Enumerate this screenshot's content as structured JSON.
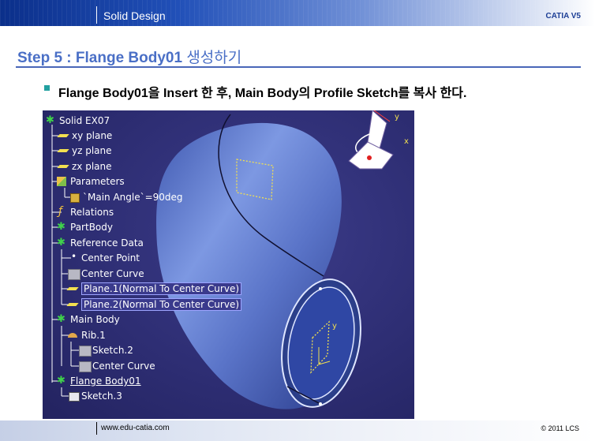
{
  "header": {
    "title": "Solid Design",
    "brand": "CATIA V5"
  },
  "step": {
    "title_en": "Step 5 : Flange Body01 ",
    "title_kr": "생성하기"
  },
  "bullet": {
    "text": "Flange Body01을 Insert 한 후, Main Body의 Profile Sketch를 복사 한다."
  },
  "tree": {
    "root": "Solid EX07",
    "xy_plane": "xy plane",
    "yz_plane": "yz plane",
    "zx_plane": "zx plane",
    "parameters": "Parameters",
    "main_angle": "`Main Angle`=90deg",
    "relations": "Relations",
    "partbody": "PartBody",
    "reference_data": "Reference Data",
    "center_point": "Center Point",
    "center_curve": "Center Curve",
    "plane1": "Plane.1(Normal To Center Curve)",
    "plane2": "Plane.2(Normal To Center Curve)",
    "main_body": "Main Body",
    "rib1": "Rib.1",
    "sketch2": "Sketch.2",
    "rib_center_curve": "Center Curve",
    "flange_body": "Flange Body01",
    "sketch3": "Sketch.3"
  },
  "compass": {
    "y_label": "y",
    "x_label": "x"
  },
  "footer": {
    "url": "www.edu-catia.com",
    "copyright": "© 2011 LCS"
  },
  "colors": {
    "title_blue": "#4a6fc6",
    "panel_bg": "#2e2e74",
    "model_blue": "#5a74c8",
    "sketch_yellow": "#f2e050"
  }
}
